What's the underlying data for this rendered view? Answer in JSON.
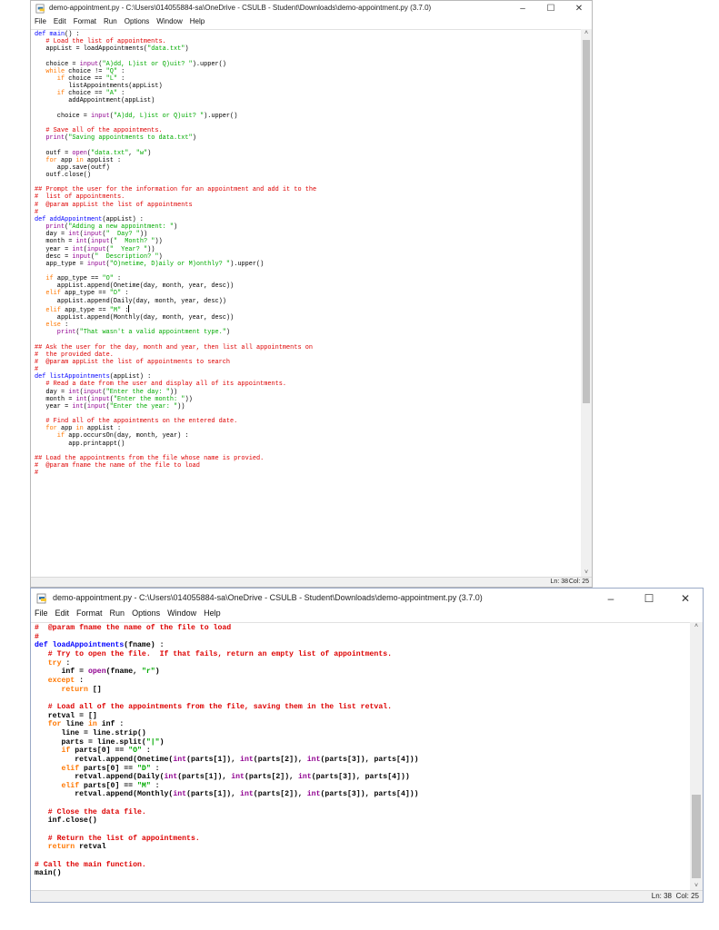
{
  "colors": {
    "keyword": "#ff7700",
    "string": "#00aa00",
    "comment": "#dd0000",
    "definition": "#0000ff",
    "builtin": "#900090"
  },
  "window1": {
    "title": "demo-appointment.py - C:\\Users\\014055884-sa\\OneDrive - CSULB - Student\\Downloads\\demo-appointment.py (3.7.0)",
    "controls": {
      "minimize": "–",
      "maximize": "☐",
      "close": "✕"
    },
    "menu": [
      "File",
      "Edit",
      "Format",
      "Run",
      "Options",
      "Window",
      "Help"
    ],
    "status": {
      "line": "Ln: 38",
      "col": "Col: 25"
    },
    "code": [
      [
        [
          "df",
          "def "
        ],
        [
          "df",
          "main"
        ],
        [
          "",
          "() :"
        ]
      ],
      [
        [
          "cm",
          "   # Load the list of appointments."
        ]
      ],
      [
        [
          "",
          "   appList = loadAppointments("
        ],
        [
          "st",
          "\"data.txt\""
        ],
        [
          "",
          ")"
        ]
      ],
      [
        [
          "",
          ""
        ]
      ],
      [
        [
          "",
          "   choice = "
        ],
        [
          "bi",
          "input"
        ],
        [
          "",
          "("
        ],
        [
          "st",
          "\"A)dd, L)ist or Q)uit? \""
        ],
        [
          "",
          ").upper()"
        ]
      ],
      [
        [
          "kw",
          "   while"
        ],
        [
          "",
          " choice != "
        ],
        [
          "st",
          "\"Q\""
        ],
        [
          "",
          " :"
        ]
      ],
      [
        [
          "kw",
          "      if"
        ],
        [
          "",
          " choice == "
        ],
        [
          "st",
          "\"L\""
        ],
        [
          "",
          " :"
        ]
      ],
      [
        [
          "",
          "         listAppointments(appList)"
        ]
      ],
      [
        [
          "kw",
          "      if"
        ],
        [
          "",
          " choice == "
        ],
        [
          "st",
          "\"A\""
        ],
        [
          "",
          " :"
        ]
      ],
      [
        [
          "",
          "         addAppointment(appList)"
        ]
      ],
      [
        [
          "",
          ""
        ]
      ],
      [
        [
          "",
          "      choice = "
        ],
        [
          "bi",
          "input"
        ],
        [
          "",
          "("
        ],
        [
          "st",
          "\"A)dd, L)ist or Q)uit? \""
        ],
        [
          "",
          ").upper()"
        ]
      ],
      [
        [
          "",
          ""
        ]
      ],
      [
        [
          "cm",
          "   # Save all of the appointments."
        ]
      ],
      [
        [
          "bi",
          "   print"
        ],
        [
          "",
          "("
        ],
        [
          "st",
          "\"Saving appointments to data.txt\""
        ],
        [
          "",
          ")"
        ]
      ],
      [
        [
          "",
          ""
        ]
      ],
      [
        [
          "",
          "   outf = "
        ],
        [
          "bi",
          "open"
        ],
        [
          "",
          "("
        ],
        [
          "st",
          "\"data.txt\""
        ],
        [
          ", ",
          ""
        ],
        [
          "st",
          "\"w\""
        ],
        [
          "",
          ")"
        ]
      ],
      [
        [
          "kw",
          "   for"
        ],
        [
          "",
          " app "
        ],
        [
          "kw",
          "in"
        ],
        [
          "",
          " appList :"
        ]
      ],
      [
        [
          "",
          "      app.save(outf)"
        ]
      ],
      [
        [
          "",
          "   outf.close()"
        ]
      ],
      [
        [
          "",
          ""
        ]
      ],
      [
        [
          "cm",
          "## Prompt the user for the information for an appointment and add it to the"
        ]
      ],
      [
        [
          "cm",
          "#  list of appointments."
        ]
      ],
      [
        [
          "cm",
          "#  @param appList the list of appointments"
        ]
      ],
      [
        [
          "cm",
          "#"
        ]
      ],
      [
        [
          "df",
          "def "
        ],
        [
          "df",
          "addAppointment"
        ],
        [
          "",
          "(appList) :"
        ]
      ],
      [
        [
          "bi",
          "   print"
        ],
        [
          "",
          "("
        ],
        [
          "st",
          "\"Adding a new appointment: \""
        ],
        [
          "",
          ")"
        ]
      ],
      [
        [
          "",
          "   day = "
        ],
        [
          "bi",
          "int"
        ],
        [
          "",
          "("
        ],
        [
          "bi",
          "input"
        ],
        [
          "",
          "("
        ],
        [
          "st",
          "\"  Day? \""
        ],
        [
          "",
          "))"
        ]
      ],
      [
        [
          "",
          "   month = "
        ],
        [
          "bi",
          "int"
        ],
        [
          "",
          "("
        ],
        [
          "bi",
          "input"
        ],
        [
          "",
          "("
        ],
        [
          "st",
          "\"  Month? \""
        ],
        [
          "",
          "))"
        ]
      ],
      [
        [
          "",
          "   year = "
        ],
        [
          "bi",
          "int"
        ],
        [
          "",
          "("
        ],
        [
          "bi",
          "input"
        ],
        [
          "",
          "("
        ],
        [
          "st",
          "\"  Year? \""
        ],
        [
          "",
          "))"
        ]
      ],
      [
        [
          "",
          "   desc = "
        ],
        [
          "bi",
          "input"
        ],
        [
          "",
          "("
        ],
        [
          "st",
          "\"  Description? \""
        ],
        [
          "",
          ")"
        ]
      ],
      [
        [
          "",
          "   app_type = "
        ],
        [
          "bi",
          "input"
        ],
        [
          "",
          "("
        ],
        [
          "st",
          "\"O)netime, D)aily or M)onthly? \""
        ],
        [
          "",
          ").upper()"
        ]
      ],
      [
        [
          "",
          ""
        ]
      ],
      [
        [
          "kw",
          "   if"
        ],
        [
          "",
          " app_type == "
        ],
        [
          "st",
          "\"O\""
        ],
        [
          "",
          " :"
        ]
      ],
      [
        [
          "",
          "      appList.append(Onetime(day, month, year, desc))"
        ]
      ],
      [
        [
          "kw",
          "   elif"
        ],
        [
          "",
          " app_type == "
        ],
        [
          "st",
          "\"D\""
        ],
        [
          "",
          " :"
        ]
      ],
      [
        [
          "",
          "      appList.append(Daily(day, month, year, desc))"
        ]
      ],
      [
        [
          "kw",
          "   elif"
        ],
        [
          "",
          " app_type == "
        ],
        [
          "st",
          "\"M\""
        ],
        [
          "",
          " :"
        ],
        [
          "CURSOR",
          ""
        ]
      ],
      [
        [
          "",
          "      appList.append(Monthly(day, month, year, desc))"
        ]
      ],
      [
        [
          "kw",
          "   else"
        ],
        [
          "",
          " :"
        ]
      ],
      [
        [
          "bi",
          "      print"
        ],
        [
          "",
          "("
        ],
        [
          "st",
          "\"That wasn't a valid appointment type.\""
        ],
        [
          "",
          ")"
        ]
      ],
      [
        [
          "",
          ""
        ]
      ],
      [
        [
          "cm",
          "## Ask the user for the day, month and year, then list all appointments on"
        ]
      ],
      [
        [
          "cm",
          "#  the provided date."
        ]
      ],
      [
        [
          "cm",
          "#  @param appList the list of appointments to search"
        ]
      ],
      [
        [
          "cm",
          "#"
        ]
      ],
      [
        [
          "df",
          "def "
        ],
        [
          "df",
          "listAppointments"
        ],
        [
          "",
          "(appList) :"
        ]
      ],
      [
        [
          "cm",
          "   # Read a date from the user and display all of its appointments."
        ]
      ],
      [
        [
          "",
          "   day = "
        ],
        [
          "bi",
          "int"
        ],
        [
          "",
          "("
        ],
        [
          "bi",
          "input"
        ],
        [
          "",
          "("
        ],
        [
          "st",
          "\"Enter the day: \""
        ],
        [
          "",
          "))"
        ]
      ],
      [
        [
          "",
          "   month = "
        ],
        [
          "bi",
          "int"
        ],
        [
          "",
          "("
        ],
        [
          "bi",
          "input"
        ],
        [
          "",
          "("
        ],
        [
          "st",
          "\"Enter the month: \""
        ],
        [
          "",
          "))"
        ]
      ],
      [
        [
          "",
          "   year = "
        ],
        [
          "bi",
          "int"
        ],
        [
          "",
          "("
        ],
        [
          "bi",
          "input"
        ],
        [
          "",
          "("
        ],
        [
          "st",
          "\"Enter the year: \""
        ],
        [
          "",
          "))"
        ]
      ],
      [
        [
          "",
          ""
        ]
      ],
      [
        [
          "cm",
          "   # Find all of the appointments on the entered date."
        ]
      ],
      [
        [
          "kw",
          "   for"
        ],
        [
          "",
          " app "
        ],
        [
          "kw",
          "in"
        ],
        [
          "",
          " appList :"
        ]
      ],
      [
        [
          "kw",
          "      if"
        ],
        [
          "",
          " app.occursOn(day, month, year) :"
        ]
      ],
      [
        [
          "",
          "         app.printappt()"
        ]
      ],
      [
        [
          "",
          ""
        ]
      ],
      [
        [
          "cm",
          "## Load the appointments from the file whose name is provied."
        ]
      ],
      [
        [
          "cm",
          "#  @param fname the name of the file to load"
        ]
      ],
      [
        [
          "cm",
          "#"
        ]
      ]
    ]
  },
  "window2": {
    "title": "demo-appointment.py - C:\\Users\\014055884-sa\\OneDrive - CSULB - Student\\Downloads\\demo-appointment.py (3.7.0)",
    "controls": {
      "minimize": "–",
      "maximize": "☐",
      "close": "✕"
    },
    "menu": [
      "File",
      "Edit",
      "Format",
      "Run",
      "Options",
      "Window",
      "Help"
    ],
    "status": {
      "line": "Ln: 38",
      "col": "Col: 25"
    },
    "code": [
      [
        [
          "cm",
          "#  @param fname the name of the file to load"
        ]
      ],
      [
        [
          "cm",
          "#"
        ]
      ],
      [
        [
          "df",
          "def "
        ],
        [
          "df",
          "loadAppointments"
        ],
        [
          "",
          "(fname) :"
        ]
      ],
      [
        [
          "cm",
          "   # Try to open the file.  If that fails, return an empty list of appointments."
        ]
      ],
      [
        [
          "kw",
          "   try"
        ],
        [
          "",
          " :"
        ]
      ],
      [
        [
          "",
          "      inf = "
        ],
        [
          "bi",
          "open"
        ],
        [
          "",
          "(fname, "
        ],
        [
          "st",
          "\"r\""
        ],
        [
          "",
          ")"
        ]
      ],
      [
        [
          "kw",
          "   except"
        ],
        [
          "",
          " :"
        ]
      ],
      [
        [
          "kw",
          "      return"
        ],
        [
          "",
          " []"
        ]
      ],
      [
        [
          "",
          ""
        ]
      ],
      [
        [
          "cm",
          "   # Load all of the appointments from the file, saving them in the list retval."
        ]
      ],
      [
        [
          "",
          "   retval = []"
        ]
      ],
      [
        [
          "kw",
          "   for"
        ],
        [
          "",
          " line "
        ],
        [
          "kw",
          "in"
        ],
        [
          "",
          " inf :"
        ]
      ],
      [
        [
          "",
          "      line = line.strip()"
        ]
      ],
      [
        [
          "",
          "      parts = line.split("
        ],
        [
          "st",
          "\"|\""
        ],
        [
          "",
          ")"
        ]
      ],
      [
        [
          "kw",
          "      if"
        ],
        [
          "",
          " parts[0] == "
        ],
        [
          "st",
          "\"O\""
        ],
        [
          "",
          " :"
        ]
      ],
      [
        [
          "",
          "         retval.append(Onetime("
        ],
        [
          "bi",
          "int"
        ],
        [
          "",
          "(parts[1]), "
        ],
        [
          "bi",
          "int"
        ],
        [
          "",
          "(parts[2]), "
        ],
        [
          "bi",
          "int"
        ],
        [
          "",
          "(parts[3]), parts[4]))"
        ]
      ],
      [
        [
          "kw",
          "      elif"
        ],
        [
          "",
          " parts[0] == "
        ],
        [
          "st",
          "\"D\""
        ],
        [
          "",
          " :"
        ]
      ],
      [
        [
          "",
          "         retval.append(Daily("
        ],
        [
          "bi",
          "int"
        ],
        [
          "",
          "(parts[1]), "
        ],
        [
          "bi",
          "int"
        ],
        [
          "",
          "(parts[2]), "
        ],
        [
          "bi",
          "int"
        ],
        [
          "",
          "(parts[3]), parts[4]))"
        ]
      ],
      [
        [
          "kw",
          "      elif"
        ],
        [
          "",
          " parts[0] == "
        ],
        [
          "st",
          "\"M\""
        ],
        [
          "",
          " :"
        ]
      ],
      [
        [
          "",
          "         retval.append(Monthly("
        ],
        [
          "bi",
          "int"
        ],
        [
          "",
          "(parts[1]), "
        ],
        [
          "bi",
          "int"
        ],
        [
          "",
          "(parts[2]), "
        ],
        [
          "bi",
          "int"
        ],
        [
          "",
          "(parts[3]), parts[4]))"
        ]
      ],
      [
        [
          "",
          ""
        ]
      ],
      [
        [
          "cm",
          "   # Close the data file."
        ]
      ],
      [
        [
          "",
          "   inf.close()"
        ]
      ],
      [
        [
          "",
          ""
        ]
      ],
      [
        [
          "cm",
          "   # Return the list of appointments."
        ]
      ],
      [
        [
          "kw",
          "   return"
        ],
        [
          "",
          " retval"
        ]
      ],
      [
        [
          "",
          ""
        ]
      ],
      [
        [
          "cm",
          "# Call the main function."
        ]
      ],
      [
        [
          "",
          "main()"
        ]
      ]
    ]
  }
}
